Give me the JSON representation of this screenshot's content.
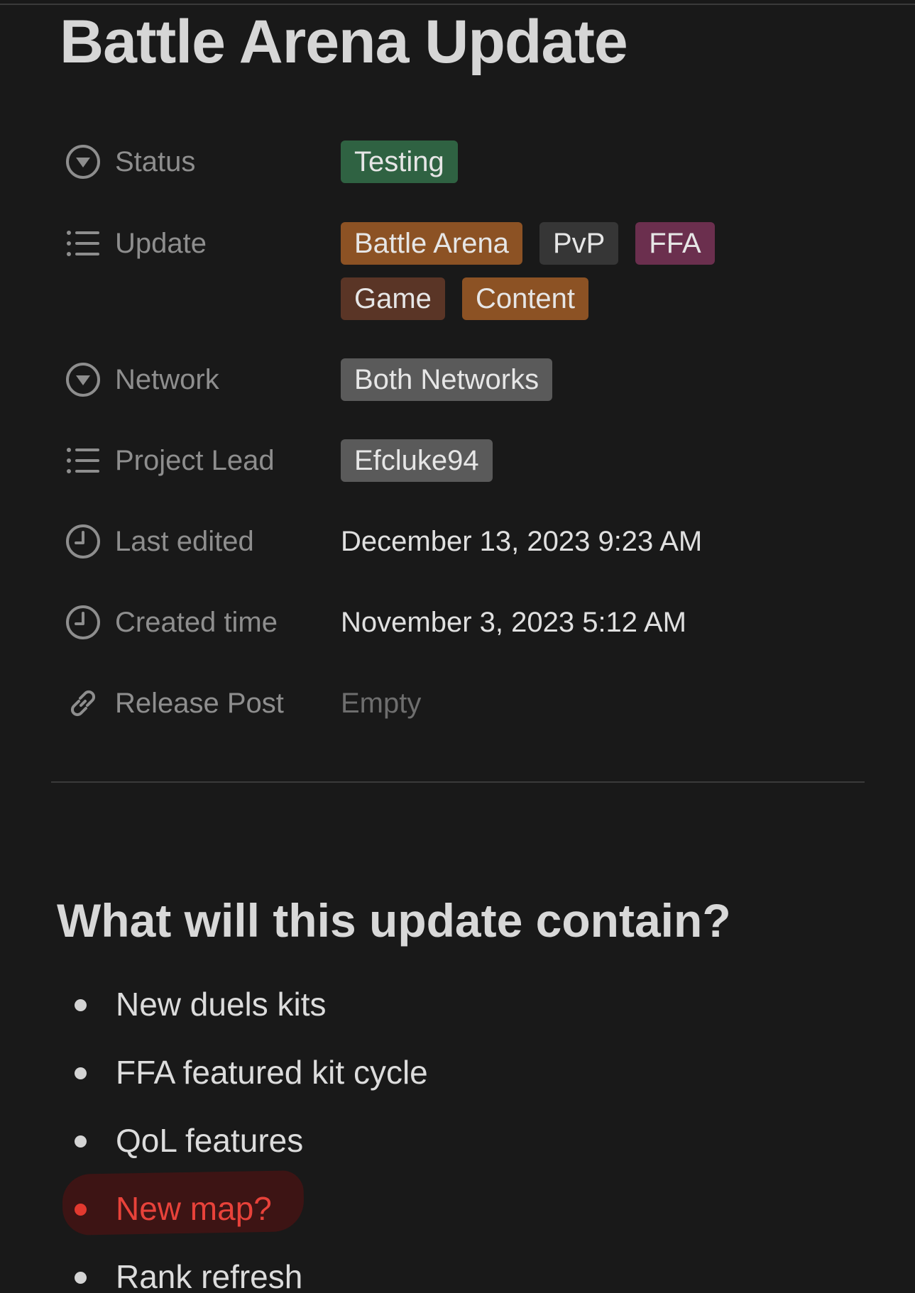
{
  "page": {
    "title": "Battle Arena Update"
  },
  "properties": [
    {
      "icon": "chevron-circle-down-icon",
      "label": "Status",
      "tags": [
        {
          "text": "Testing",
          "color": "#2f6242"
        }
      ]
    },
    {
      "icon": "list-icon",
      "label": "Update",
      "tags": [
        {
          "text": "Battle Arena",
          "color": "#8c5224"
        },
        {
          "text": "PvP",
          "color": "#363636"
        },
        {
          "text": "FFA",
          "color": "#6b2f4e"
        },
        {
          "text": "Game",
          "color": "#5a3526"
        },
        {
          "text": "Content",
          "color": "#8c5224"
        }
      ]
    },
    {
      "icon": "chevron-circle-down-icon",
      "label": "Network",
      "tags": [
        {
          "text": "Both Networks",
          "color": "#5a5a5a"
        }
      ]
    },
    {
      "icon": "list-icon",
      "label": "Project Lead",
      "tags": [
        {
          "text": "Efcluke94",
          "color": "#5a5a5a"
        }
      ]
    },
    {
      "icon": "clock-icon",
      "label": "Last edited",
      "value": "December 13, 2023 9:23 AM"
    },
    {
      "icon": "clock-icon",
      "label": "Created time",
      "value": "November 3, 2023 5:12 AM"
    },
    {
      "icon": "link-icon",
      "label": "Release Post",
      "value": "Empty",
      "empty": true
    }
  ],
  "content": {
    "heading": "What will this update contain?",
    "bullets": [
      {
        "text": "New duels kits",
        "highlight": false
      },
      {
        "text": "FFA featured kit cycle",
        "highlight": false
      },
      {
        "text": "QoL features",
        "highlight": false
      },
      {
        "text": "New map?",
        "highlight": true,
        "color": "#e8423a"
      },
      {
        "text": "Rank refresh",
        "highlight": false
      }
    ]
  }
}
